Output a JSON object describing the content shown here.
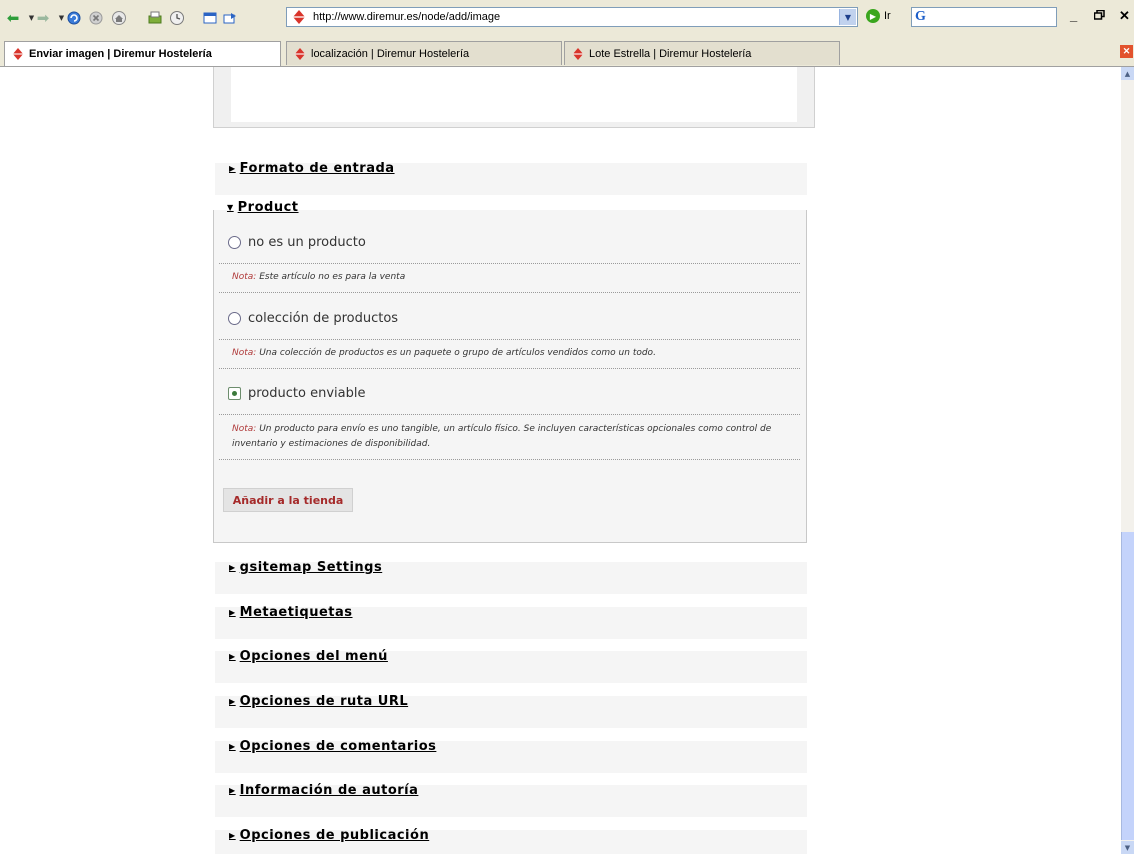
{
  "browser": {
    "url": "http://www.diremur.es/node/add/image",
    "go_label": "Ir",
    "google_logo": "G",
    "tabs": [
      {
        "label": "Enviar imagen | Diremur Hostelería",
        "active": true
      },
      {
        "label": "localización | Diremur Hostelería",
        "active": false
      },
      {
        "label": "Lote Estrella | Diremur Hostelería",
        "active": false
      }
    ],
    "window_controls": {
      "minimize": "_",
      "restore": "🗗",
      "close": "✕"
    }
  },
  "form": {
    "collapsed_top": {
      "label": "Formato de entrada"
    },
    "product": {
      "legend": "Product",
      "options": [
        {
          "label": "no es un producto",
          "checked": false,
          "note_label": "Nota:",
          "note": "Este artículo no es para la venta"
        },
        {
          "label": "colección de productos",
          "checked": false,
          "note_label": "Nota:",
          "note": "Una colección de productos es un paquete o grupo de artículos vendidos como un todo."
        },
        {
          "label": "producto enviable",
          "checked": true,
          "note_label": "Nota:",
          "note": "Un producto para envío es uno tangible, un artículo físico. Se incluyen características opcionales como control de inventario y estimaciones de disponibilidad."
        }
      ],
      "button": "Añadir a la tienda"
    },
    "collapsed_sections": [
      {
        "label": "gsitemap Settings"
      },
      {
        "label": "Metaetiquetas"
      },
      {
        "label": "Opciones del menú"
      },
      {
        "label": "Opciones de ruta URL"
      },
      {
        "label": "Opciones de comentarios"
      },
      {
        "label": "Información de autoría"
      },
      {
        "label": "Opciones de publicación"
      }
    ]
  },
  "colors": {
    "brand": "#d9342b",
    "note_label": "#b03a3a",
    "button_text": "#a52a2a"
  }
}
